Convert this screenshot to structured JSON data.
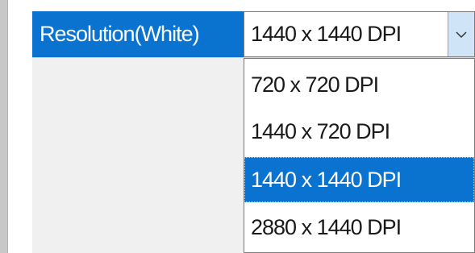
{
  "property": {
    "label": "Resolution(White)"
  },
  "combo": {
    "value": "1440 x 1440 DPI",
    "icon": "chevron-down-icon"
  },
  "dropdown": {
    "options": [
      "720 x 720 DPI",
      "1440 x 720 DPI",
      "1440 x 1440 DPI",
      "2880 x 1440 DPI"
    ],
    "selected": "1440 x 1440 DPI"
  },
  "colors": {
    "selection": "#0a73d0",
    "combo_button": "#cfe4f7"
  }
}
